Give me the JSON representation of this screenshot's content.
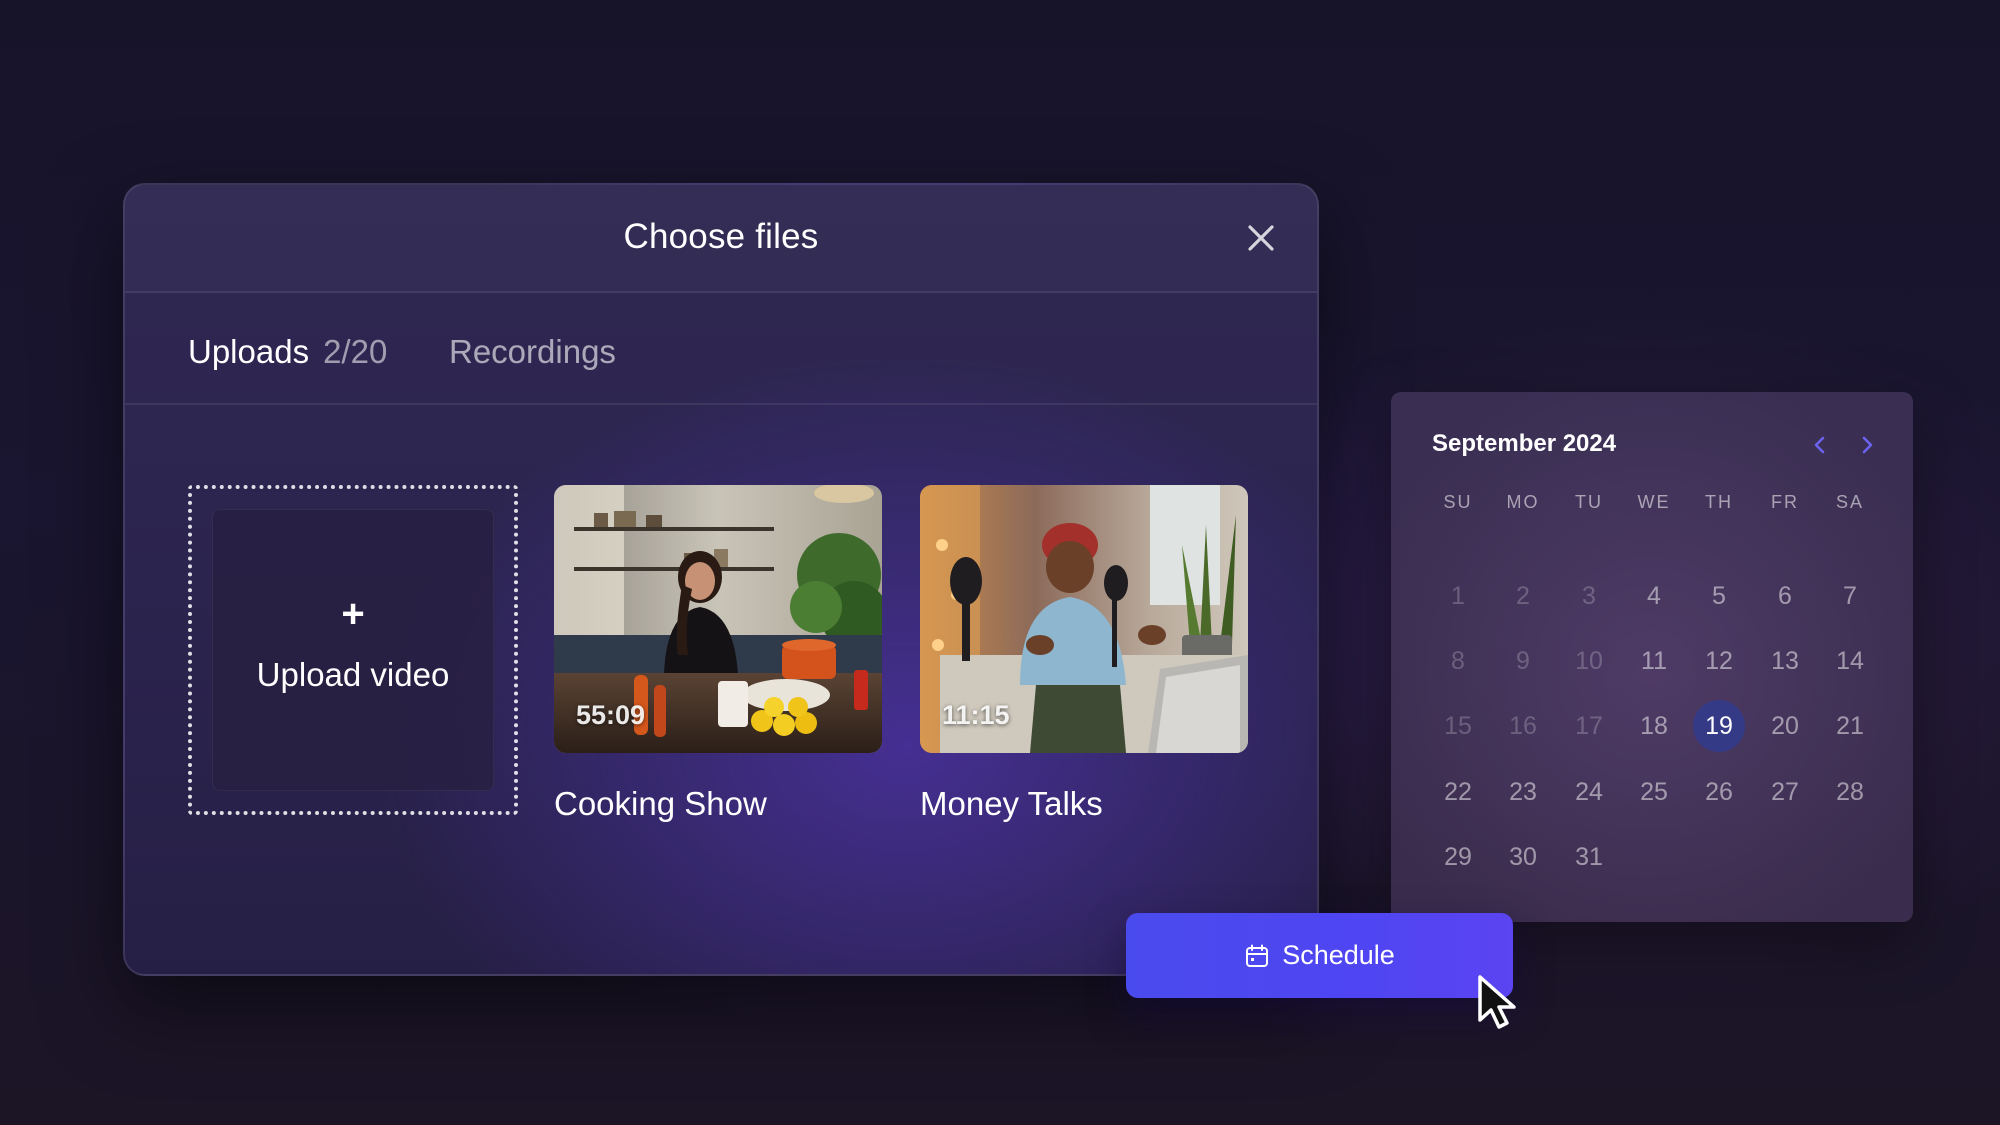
{
  "dialog": {
    "title": "Choose files",
    "close_icon": "close-icon"
  },
  "tabs": {
    "uploads": {
      "label": "Uploads",
      "count": "2/20"
    },
    "recordings": {
      "label": "Recordings"
    }
  },
  "upload": {
    "icon": "+",
    "label": "Upload video"
  },
  "videos": [
    {
      "title": "Cooking Show",
      "duration": "55:09"
    },
    {
      "title": "Money Talks",
      "duration": "11:15"
    }
  ],
  "calendar": {
    "month": "September 2024",
    "weekdays": [
      "SU",
      "MO",
      "TU",
      "WE",
      "TH",
      "FR",
      "SA"
    ],
    "days": [
      [
        "1",
        "2",
        "3",
        "4",
        "5",
        "6",
        "7"
      ],
      [
        "8",
        "9",
        "10",
        "11",
        "12",
        "13",
        "14"
      ],
      [
        "15",
        "16",
        "17",
        "18",
        "19",
        "20",
        "21"
      ],
      [
        "22",
        "23",
        "24",
        "25",
        "26",
        "27",
        "28"
      ],
      [
        "29",
        "30",
        "31"
      ]
    ],
    "selected_day": "19",
    "nav_color": "#6b63f0"
  },
  "schedule": {
    "label": "Schedule",
    "icon": "calendar-icon",
    "color": "#4f45f2"
  }
}
